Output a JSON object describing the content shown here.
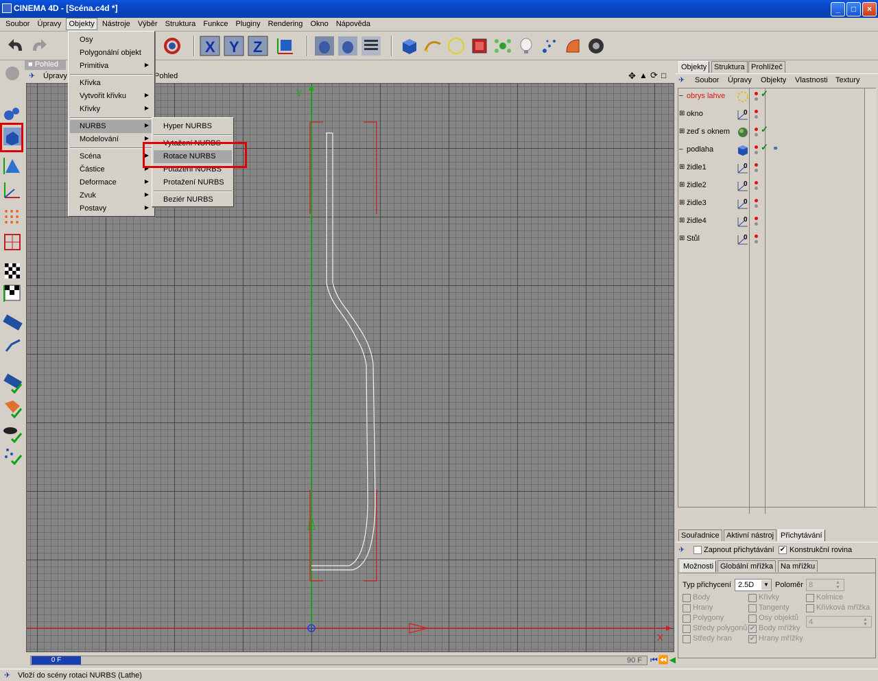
{
  "window": {
    "title": "CINEMA 4D - [Scéna.c4d *]"
  },
  "menubar": [
    "Soubor",
    "Úpravy",
    "Objekty",
    "Nástroje",
    "Výběr",
    "Struktura",
    "Funkce",
    "Pluginy",
    "Rendering",
    "Okno",
    "Nápověda"
  ],
  "objekty_menu": {
    "items": [
      "Osy",
      "Polygonální objekt",
      "Primitiva",
      "Křivka",
      "Vytvořit křivku",
      "Křivky",
      "NURBS",
      "Modelování",
      "Scéna",
      "Částice",
      "Deformace",
      "Zvuk",
      "Postavy"
    ]
  },
  "nurbs_submenu": {
    "items": [
      "Hyper NURBS",
      "Vytažení NURBS",
      "Rotace NURBS",
      "Potažení NURBS",
      "Protažení NURBS",
      "Beziér NURBS"
    ]
  },
  "viewport": {
    "tab": "Pohled",
    "menu_visible": [
      "Úpravy",
      "Pohled"
    ],
    "axis_y": "Y",
    "axis_x": "X"
  },
  "timeline": {
    "current_frame": "0 F",
    "end_frame": "90 F"
  },
  "status": {
    "text": "Vloží do scény rotaci NURBS (Lathe)"
  },
  "right_panel": {
    "top_tabs": [
      "Objekty",
      "Struktura",
      "Prohlížeč"
    ],
    "obj_menu": [
      "Soubor",
      "Úpravy",
      "Objekty",
      "Vlastnosti",
      "Textury"
    ],
    "objects": [
      {
        "name": "obrys lahve",
        "expandable": false,
        "selected": true,
        "check": true
      },
      {
        "name": "okno",
        "expandable": true,
        "check": false
      },
      {
        "name": "zeď s oknem",
        "expandable": true,
        "check": true
      },
      {
        "name": "podlaha",
        "expandable": false,
        "check": true
      },
      {
        "name": "židle1",
        "expandable": true,
        "check": false
      },
      {
        "name": "židle2",
        "expandable": true,
        "check": false
      },
      {
        "name": "židle3",
        "expandable": true,
        "check": false
      },
      {
        "name": "židle4",
        "expandable": true,
        "check": false
      },
      {
        "name": "Stůl",
        "expandable": true,
        "check": false
      }
    ],
    "attr_tabs": [
      "Souřadnice",
      "Aktivní nástroj",
      "Přichytávání"
    ],
    "zapnout": "Zapnout přichytávání",
    "konstrukcni": "Konstrukční rovina",
    "sub_tabs": [
      "Možnosti",
      "Globální mřížka",
      "Na mřížku"
    ],
    "typ_label": "Typ přichycení",
    "typ_value": "2.5D",
    "polomer_label": "Poloměr",
    "polomer_value": "8",
    "col1": [
      "Body",
      "Hrany",
      "Polygony",
      "Středy polygonů",
      "Středy hran"
    ],
    "col2": [
      "Křivky",
      "Tangenty",
      "Osy objektů",
      "Body mřížky",
      "Hrany mřížky"
    ],
    "col3": [
      "Kolmice",
      "Křivková mřížka"
    ],
    "extra_value": "4"
  }
}
